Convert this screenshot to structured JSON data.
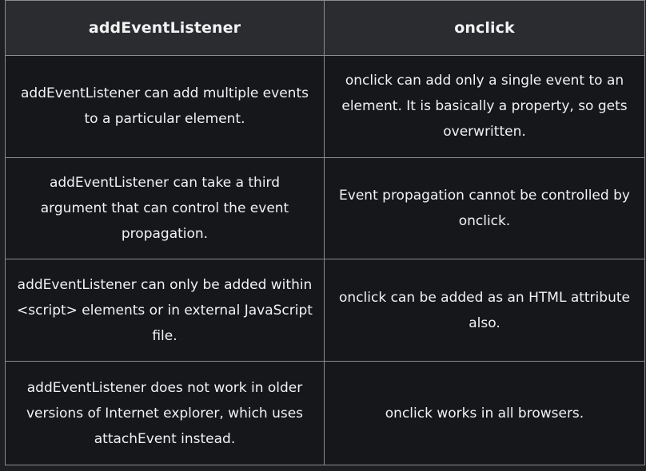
{
  "table": {
    "headers": [
      "addEventListener",
      "onclick"
    ],
    "rows": [
      [
        "addEventListener can add multiple events to a particular element.",
        "onclick can add only a single event to an element. It is basically a property, so gets overwritten."
      ],
      [
        "addEventListener can take a third argument that can control the event propagation.",
        "Event propagation cannot be controlled by onclick."
      ],
      [
        "addEventListener can only be added within <script> elements or in external JavaScript file.",
        "onclick can be added as an HTML attribute also."
      ],
      [
        "addEventListener does not work in older versions of Internet explorer, which uses attachEvent instead.",
        "onclick works in all browsers."
      ]
    ]
  }
}
